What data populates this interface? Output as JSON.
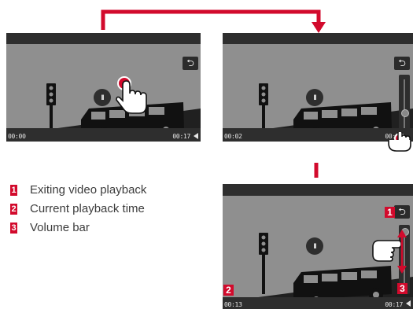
{
  "screens": {
    "s1": {
      "time_left": "00:00",
      "time_right": "00:17"
    },
    "s2": {
      "time_left": "00:02",
      "time_right": "00:17"
    },
    "s3": {
      "time_left": "00:13",
      "time_right": "00:17"
    }
  },
  "callouts": [
    "1",
    "2",
    "3"
  ],
  "legend": [
    {
      "num": "1",
      "label": "Exiting video playback"
    },
    {
      "num": "2",
      "label": "Current playback time"
    },
    {
      "num": "3",
      "label": "Volume bar"
    }
  ],
  "colors": {
    "accent": "#d20a2c",
    "screen_bg": "#8f8f8f",
    "bar": "#2e2e2e"
  },
  "icons": [
    "back-arrow-icon",
    "pause-icon",
    "speaker-icon",
    "hand-pointer-icon",
    "volume-slider-icon",
    "traffic-light",
    "bus-silhouette"
  ]
}
